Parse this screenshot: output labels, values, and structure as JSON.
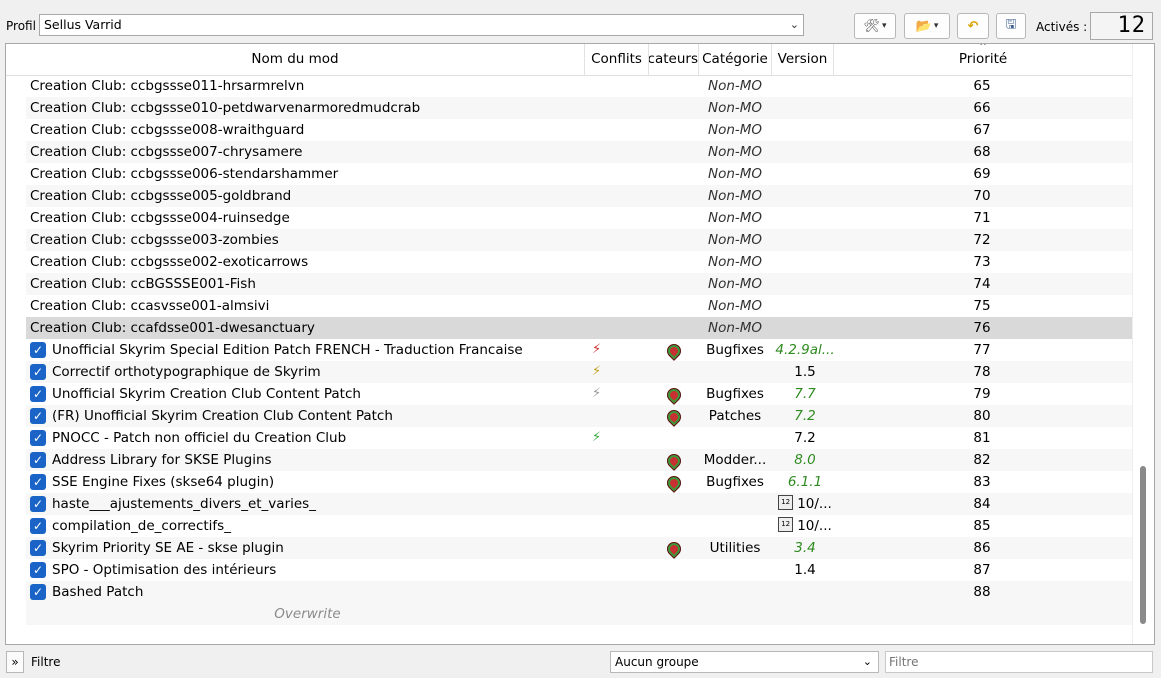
{
  "toolbar": {
    "profile_label": "Profil",
    "profile_value": "Sellus Varrid",
    "actives_label": "Activés :",
    "actives_value": "12"
  },
  "columns": {
    "name": "Nom du mod",
    "conflicts": "Conflits",
    "flags": "Indicateurs",
    "category": "Catégorie",
    "version": "Version",
    "priority": "Priorité"
  },
  "rows": [
    {
      "name": "Creation Club: ccbgssse011-hrsarmrelvn",
      "checked": false,
      "conflict": "",
      "flag": false,
      "category": "Non-MO",
      "version": "",
      "version_style": "",
      "priority": "65"
    },
    {
      "name": "Creation Club: ccbgssse010-petdwarvenarmoredmudcrab",
      "checked": false,
      "conflict": "",
      "flag": false,
      "category": "Non-MO",
      "version": "",
      "version_style": "",
      "priority": "66"
    },
    {
      "name": "Creation Club: ccbgssse008-wraithguard",
      "checked": false,
      "conflict": "",
      "flag": false,
      "category": "Non-MO",
      "version": "",
      "version_style": "",
      "priority": "67"
    },
    {
      "name": "Creation Club: ccbgssse007-chrysamere",
      "checked": false,
      "conflict": "",
      "flag": false,
      "category": "Non-MO",
      "version": "",
      "version_style": "",
      "priority": "68"
    },
    {
      "name": "Creation Club: ccbgssse006-stendarshammer",
      "checked": false,
      "conflict": "",
      "flag": false,
      "category": "Non-MO",
      "version": "",
      "version_style": "",
      "priority": "69"
    },
    {
      "name": "Creation Club: ccbgssse005-goldbrand",
      "checked": false,
      "conflict": "",
      "flag": false,
      "category": "Non-MO",
      "version": "",
      "version_style": "",
      "priority": "70"
    },
    {
      "name": "Creation Club: ccbgssse004-ruinsedge",
      "checked": false,
      "conflict": "",
      "flag": false,
      "category": "Non-MO",
      "version": "",
      "version_style": "",
      "priority": "71"
    },
    {
      "name": "Creation Club: ccbgssse003-zombies",
      "checked": false,
      "conflict": "",
      "flag": false,
      "category": "Non-MO",
      "version": "",
      "version_style": "",
      "priority": "72"
    },
    {
      "name": "Creation Club: ccbgssse002-exoticarrows",
      "checked": false,
      "conflict": "",
      "flag": false,
      "category": "Non-MO",
      "version": "",
      "version_style": "",
      "priority": "73"
    },
    {
      "name": "Creation Club: ccBGSSSE001-Fish",
      "checked": false,
      "conflict": "",
      "flag": false,
      "category": "Non-MO",
      "version": "",
      "version_style": "",
      "priority": "74"
    },
    {
      "name": "Creation Club: ccasvsse001-almsivi",
      "checked": false,
      "conflict": "",
      "flag": false,
      "category": "Non-MO",
      "version": "",
      "version_style": "",
      "priority": "75"
    },
    {
      "name": "Creation Club: ccafdsse001-dwesanctuary",
      "checked": false,
      "conflict": "",
      "flag": false,
      "category": "Non-MO",
      "version": "",
      "version_style": "",
      "priority": "76",
      "selected": true
    },
    {
      "name": "Unofficial Skyrim Special Edition Patch FRENCH - Traduction Francaise",
      "checked": true,
      "conflict": "overwritten",
      "flag": true,
      "category": "Bugfixes",
      "version": "4.2.9al...",
      "version_style": "green",
      "priority": "77"
    },
    {
      "name": "Correctif orthotypographique de Skyrim",
      "checked": true,
      "conflict": "mixed",
      "flag": false,
      "category": "",
      "version": "1.5",
      "version_style": "",
      "priority": "78"
    },
    {
      "name": "Unofficial Skyrim Creation Club Content Patch",
      "checked": true,
      "conflict": "redundant",
      "flag": true,
      "category": "Bugfixes",
      "version": "7.7",
      "version_style": "green",
      "priority": "79"
    },
    {
      "name": "(FR) Unofficial Skyrim Creation Club Content Patch",
      "checked": true,
      "conflict": "",
      "flag": true,
      "category": "Patches",
      "version": "7.2",
      "version_style": "green",
      "priority": "80"
    },
    {
      "name": "PNOCC - Patch non officiel du Creation Club",
      "checked": true,
      "conflict": "overwrite",
      "flag": false,
      "category": "",
      "version": "7.2",
      "version_style": "",
      "priority": "81"
    },
    {
      "name": "Address Library for SKSE Plugins",
      "checked": true,
      "conflict": "",
      "flag": true,
      "category": "Modder...",
      "version": "8.0",
      "version_style": "green",
      "priority": "82"
    },
    {
      "name": "SSE Engine Fixes (skse64 plugin)",
      "checked": true,
      "conflict": "",
      "flag": true,
      "category": "Bugfixes",
      "version": "6.1.1",
      "version_style": "green",
      "priority": "83"
    },
    {
      "name": "haste___ajustements_divers_et_varies_",
      "checked": true,
      "conflict": "",
      "flag": false,
      "category": "",
      "version": "10/...",
      "version_style": "date",
      "priority": "84"
    },
    {
      "name": "compilation_de_correctifs_",
      "checked": true,
      "conflict": "",
      "flag": false,
      "category": "",
      "version": "10/...",
      "version_style": "date",
      "priority": "85"
    },
    {
      "name": "Skyrim Priority SE AE - skse plugin",
      "checked": true,
      "conflict": "",
      "flag": true,
      "category": "Utilities",
      "version": "3.4",
      "version_style": "green",
      "priority": "86"
    },
    {
      "name": "SPO - Optimisation des intérieurs",
      "checked": true,
      "conflict": "",
      "flag": false,
      "category": "",
      "version": "1.4",
      "version_style": "",
      "priority": "87"
    },
    {
      "name": "Bashed Patch",
      "checked": true,
      "conflict": "",
      "flag": false,
      "category": "",
      "version": "",
      "version_style": "",
      "priority": "88"
    }
  ],
  "overwrite_label": "Overwrite",
  "bottom": {
    "filter_toggle": "»",
    "filter_label": "Filtre",
    "group_value": "Aucun groupe",
    "filter_placeholder": "Filtre"
  },
  "icons": {
    "tools": "tools-icon",
    "folder": "folder-icon",
    "undo": "undo-icon",
    "save": "save-icon"
  }
}
